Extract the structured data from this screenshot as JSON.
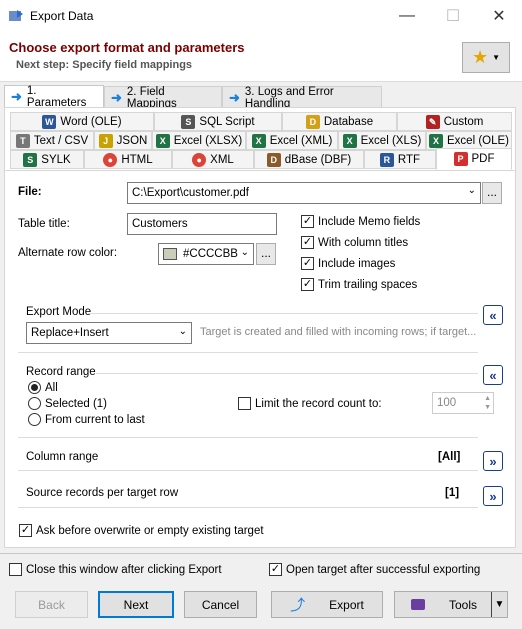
{
  "window": {
    "title": "Export Data"
  },
  "header": {
    "title": "Choose export format and parameters",
    "subtitle": "Next step: Specify field mappings"
  },
  "steps": [
    {
      "label": "1. Parameters"
    },
    {
      "label": "2. Field Mappings"
    },
    {
      "label": "3. Logs and Error Handling"
    }
  ],
  "formats": {
    "row1": [
      "Word (OLE)",
      "SQL Script",
      "Database",
      "Custom"
    ],
    "row2": [
      "Text / CSV",
      "JSON",
      "Excel (XLSX)",
      "Excel (XML)",
      "Excel (XLS)",
      "Excel (OLE)"
    ],
    "row3": [
      "SYLK",
      "HTML",
      "XML",
      "dBase (DBF)",
      "RTF",
      "PDF"
    ]
  },
  "form": {
    "file_label": "File:",
    "file_value": "C:\\Export\\customer.pdf",
    "browse": "...",
    "table_title_label": "Table title:",
    "table_title_value": "Customers",
    "alt_color_label": "Alternate row color:",
    "alt_color_value": "#CCCCBB",
    "options": [
      "Include Memo fields",
      "With column titles",
      "Include images",
      "Trim trailing spaces"
    ]
  },
  "export_mode": {
    "title": "Export Mode",
    "value": "Replace+Insert",
    "description": "Target is created and filled with incoming rows; if target..."
  },
  "record_range": {
    "title": "Record range",
    "options": [
      "All",
      "Selected (1)",
      "From current to last"
    ],
    "limit_label": "Limit the record count to:",
    "limit_value": "100"
  },
  "column_range": {
    "title": "Column range",
    "value": "[All]"
  },
  "source_records": {
    "title": "Source records per target row",
    "value": "[1]"
  },
  "ask_overwrite": "Ask before overwrite or empty existing target",
  "footer": {
    "close_after": "Close this window after clicking Export",
    "open_target": "Open target after successful exporting",
    "back": "Back",
    "next": "Next",
    "cancel": "Cancel",
    "export": "Export",
    "tools": "Tools"
  },
  "colors": {
    "accent": "#7a0000",
    "swatch": "#CCCCBB"
  }
}
